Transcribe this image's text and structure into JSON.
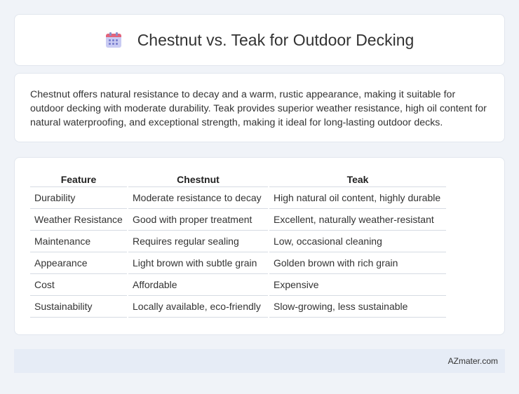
{
  "header": {
    "title": "Chestnut vs. Teak for Outdoor Decking",
    "icon": "calendar-icon"
  },
  "description": "Chestnut offers natural resistance to decay and a warm, rustic appearance, making it suitable for outdoor decking with moderate durability. Teak provides superior weather resistance, high oil content for natural waterproofing, and exceptional strength, making it ideal for long-lasting outdoor decks.",
  "table": {
    "headers": [
      "Feature",
      "Chestnut",
      "Teak"
    ],
    "rows": [
      [
        "Durability",
        "Moderate resistance to decay",
        "High natural oil content, highly durable"
      ],
      [
        "Weather Resistance",
        "Good with proper treatment",
        "Excellent, naturally weather-resistant"
      ],
      [
        "Maintenance",
        "Requires regular sealing",
        "Low, occasional cleaning"
      ],
      [
        "Appearance",
        "Light brown with subtle grain",
        "Golden brown with rich grain"
      ],
      [
        "Cost",
        "Affordable",
        "Expensive"
      ],
      [
        "Sustainability",
        "Locally available, eco-friendly",
        "Slow-growing, less sustainable"
      ]
    ]
  },
  "footer": {
    "brand": "AZmater.com"
  },
  "colors": {
    "background": "#f0f3f8",
    "card": "#ffffff",
    "footer": "#e6ecf6",
    "icon_top": "#e2637b",
    "icon_body": "#c9cbf3"
  }
}
